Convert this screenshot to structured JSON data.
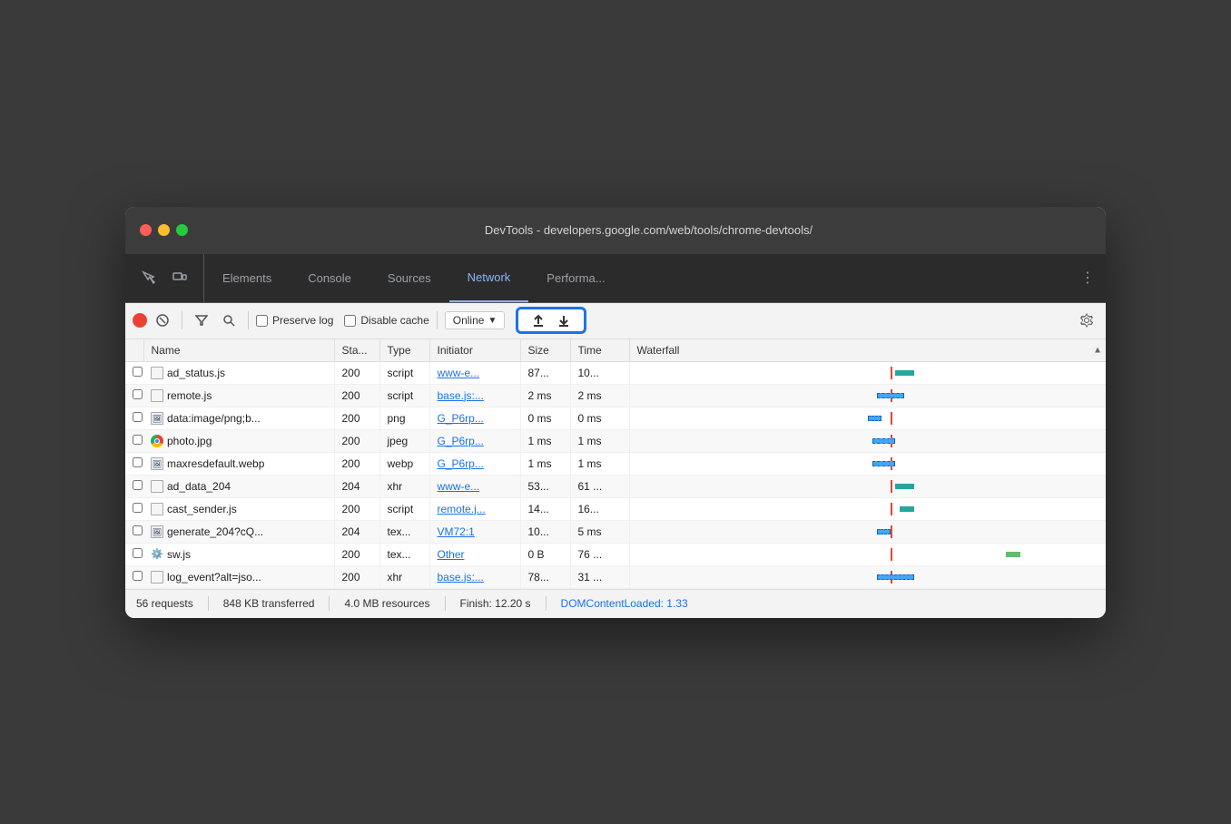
{
  "window": {
    "title": "DevTools - developers.google.com/web/tools/chrome-devtools/"
  },
  "tabs": [
    {
      "id": "elements",
      "label": "Elements",
      "active": false
    },
    {
      "id": "console",
      "label": "Console",
      "active": false
    },
    {
      "id": "sources",
      "label": "Sources",
      "active": false
    },
    {
      "id": "network",
      "label": "Network",
      "active": true
    },
    {
      "id": "performance",
      "label": "Performa...",
      "active": false
    }
  ],
  "toolbar": {
    "preserve_log_label": "Preserve log",
    "disable_cache_label": "Disable cache",
    "online_label": "Online",
    "upload_icon": "↑",
    "download_icon": "↓"
  },
  "table": {
    "columns": [
      {
        "id": "name",
        "label": "Name"
      },
      {
        "id": "status",
        "label": "Sta..."
      },
      {
        "id": "type",
        "label": "Type"
      },
      {
        "id": "initiator",
        "label": "Initiator"
      },
      {
        "id": "size",
        "label": "Size"
      },
      {
        "id": "time",
        "label": "Time"
      },
      {
        "id": "waterfall",
        "label": "Waterfall"
      }
    ],
    "rows": [
      {
        "name": "ad_status.js",
        "status": "200",
        "type": "script",
        "initiator": "www-e...",
        "size": "87...",
        "time": "10...",
        "file_type": "text"
      },
      {
        "name": "remote.js",
        "status": "200",
        "type": "script",
        "initiator": "base.js:...",
        "size": "2 ms",
        "time": "2 ms",
        "file_type": "text"
      },
      {
        "name": "data:image/png;b...",
        "status": "200",
        "type": "png",
        "initiator": "G_P6rp...",
        "size": "0 ms",
        "time": "0 ms",
        "file_type": "image"
      },
      {
        "name": "photo.jpg",
        "status": "200",
        "type": "jpeg",
        "initiator": "G_P6rp...",
        "size": "1 ms",
        "time": "1 ms",
        "file_type": "chrome"
      },
      {
        "name": "maxresdefault.webp",
        "status": "200",
        "type": "webp",
        "initiator": "G_P6rp...",
        "size": "1 ms",
        "time": "1 ms",
        "file_type": "image"
      },
      {
        "name": "ad_data_204",
        "status": "204",
        "type": "xhr",
        "initiator": "www-e...",
        "size": "53...",
        "time": "61 ...",
        "file_type": "text"
      },
      {
        "name": "cast_sender.js",
        "status": "200",
        "type": "script",
        "initiator": "remote.j...",
        "size": "14...",
        "time": "16...",
        "file_type": "text"
      },
      {
        "name": "generate_204?cQ...",
        "status": "204",
        "type": "tex...",
        "initiator": "VM72:1",
        "size": "10...",
        "time": "5 ms",
        "file_type": "image"
      },
      {
        "name": "sw.js",
        "status": "200",
        "type": "tex...",
        "initiator": "Other",
        "size": "0 B",
        "time": "76 ...",
        "file_type": "gear"
      },
      {
        "name": "log_event?alt=jso...",
        "status": "200",
        "type": "xhr",
        "initiator": "base.js:...",
        "size": "78...",
        "time": "31 ...",
        "file_type": "text"
      }
    ]
  },
  "status_bar": {
    "requests": "56 requests",
    "transferred": "848 KB transferred",
    "resources": "4.0 MB resources",
    "finish": "Finish: 12.20 s",
    "dom_content_loaded": "DOMContentLoaded: 1.33"
  }
}
